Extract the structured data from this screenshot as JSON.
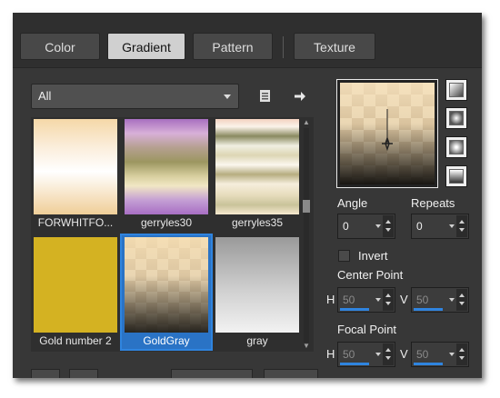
{
  "tabs": [
    {
      "label": "Color"
    },
    {
      "label": "Gradient"
    },
    {
      "label": "Pattern"
    },
    {
      "label": "Texture"
    }
  ],
  "filter": {
    "value": "All"
  },
  "gradients": [
    {
      "name": "FORWHITFO..."
    },
    {
      "name": "gerryles30"
    },
    {
      "name": "gerryles35"
    },
    {
      "name": "Gold number 2"
    },
    {
      "name": "GoldGray",
      "selected": true
    },
    {
      "name": "gray"
    }
  ],
  "angle": {
    "label": "Angle",
    "value": "0"
  },
  "repeats": {
    "label": "Repeats",
    "value": "0"
  },
  "invert": {
    "label": "Invert",
    "checked": false
  },
  "center_point": {
    "label": "Center Point",
    "h_label": "H",
    "h_value": "50",
    "v_label": "V",
    "v_value": "50"
  },
  "focal_point": {
    "label": "Focal Point",
    "h_label": "H",
    "h_value": "50",
    "v_label": "V",
    "v_value": "50"
  },
  "colors": {
    "accent": "#2f84df",
    "panel": "#373737"
  }
}
